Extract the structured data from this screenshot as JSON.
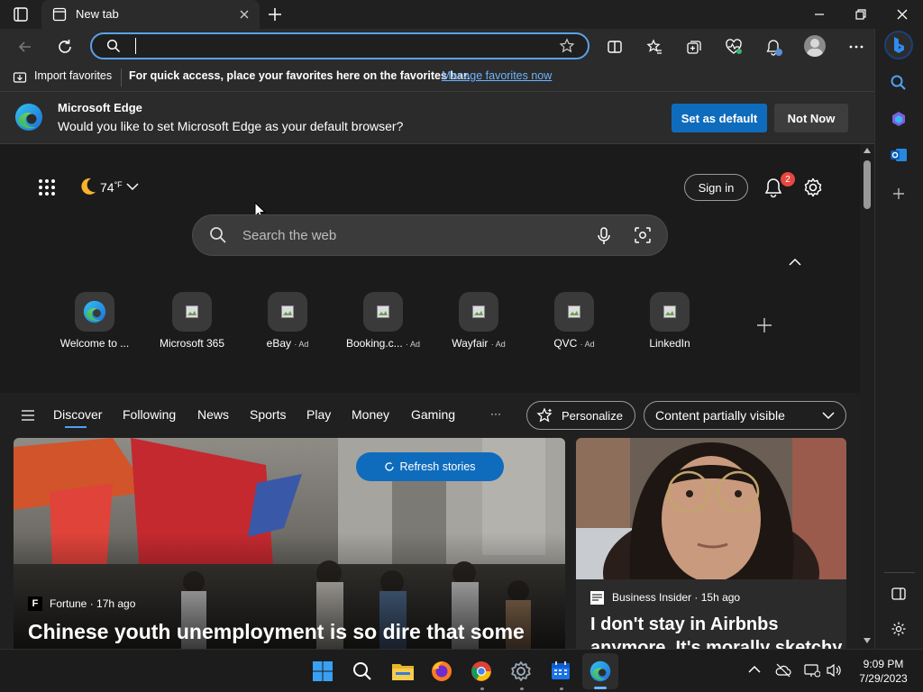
{
  "window": {
    "tab_title": "New tab"
  },
  "address_bar": {
    "value": ""
  },
  "favorites_bar": {
    "import_label": "Import favorites",
    "message": "For quick access, place your favorites here on the favorites bar.",
    "manage_link": "Manage favorites now"
  },
  "default_banner": {
    "title": "Microsoft Edge",
    "message": "Would you like to set Microsoft Edge as your default browser?",
    "set_default_label": "Set as default",
    "not_now_label": "Not Now"
  },
  "newtab": {
    "weather": {
      "temp": "74",
      "unit": "°F"
    },
    "sign_in_label": "Sign in",
    "notification_count": "2",
    "search_placeholder": "Search the web",
    "quick_links": [
      {
        "label": "Welcome to ...",
        "ad": ""
      },
      {
        "label": "Microsoft 365",
        "ad": ""
      },
      {
        "label": "eBay",
        "ad": "· Ad"
      },
      {
        "label": "Booking.c...",
        "ad": "· Ad"
      },
      {
        "label": "Wayfair",
        "ad": "· Ad"
      },
      {
        "label": "QVC",
        "ad": "· Ad"
      },
      {
        "label": "LinkedIn",
        "ad": ""
      }
    ],
    "feed_tabs": [
      "Discover",
      "Following",
      "News",
      "Sports",
      "Play",
      "Money",
      "Gaming"
    ],
    "more_label": "···",
    "personalize_label": "Personalize",
    "content_visibility": "Content partially visible",
    "refresh_label": "Refresh stories",
    "stories": [
      {
        "source_badge": "F",
        "source": "Fortune",
        "time": "17h ago",
        "headline": "Chinese youth unemployment is so dire that some"
      },
      {
        "source": "Business Insider",
        "time": "15h ago",
        "headline": "I don't stay in Airbnbs anymore. It's morally sketchy"
      }
    ]
  },
  "taskbar": {
    "time": "9:09 PM",
    "date": "7/29/2023"
  },
  "colors": {
    "accent": "#0f6cbd",
    "focus_ring": "#5aa2e8",
    "link": "#6cb4ff",
    "badge": "#e8473f"
  }
}
